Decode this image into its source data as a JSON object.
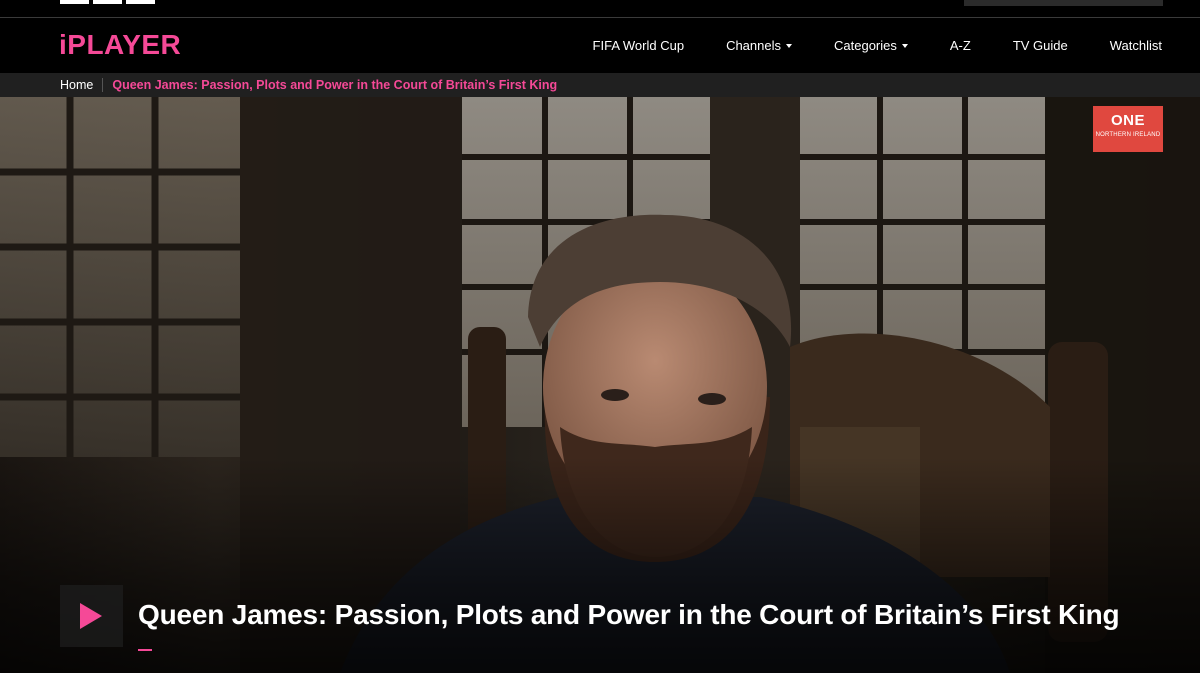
{
  "brand": {
    "name": "iPLAYER",
    "accent": "#f54997"
  },
  "nav": {
    "items": [
      {
        "label": "FIFA World Cup",
        "dropdown": false
      },
      {
        "label": "Channels",
        "dropdown": true
      },
      {
        "label": "Categories",
        "dropdown": true
      },
      {
        "label": "A-Z",
        "dropdown": false
      },
      {
        "label": "TV Guide",
        "dropdown": false
      },
      {
        "label": "Watchlist",
        "dropdown": false
      }
    ]
  },
  "breadcrumb": {
    "home": "Home",
    "current": "Queen James: Passion, Plots and Power in the Court of Britain’s First King"
  },
  "hero": {
    "channel": {
      "name": "ONE",
      "region": "NORTHERN IRELAND",
      "color": "#e0483f"
    },
    "title": "Queen James: Passion, Plots and Power in the Court of Britain’s First King",
    "play_icon": "play-icon"
  }
}
